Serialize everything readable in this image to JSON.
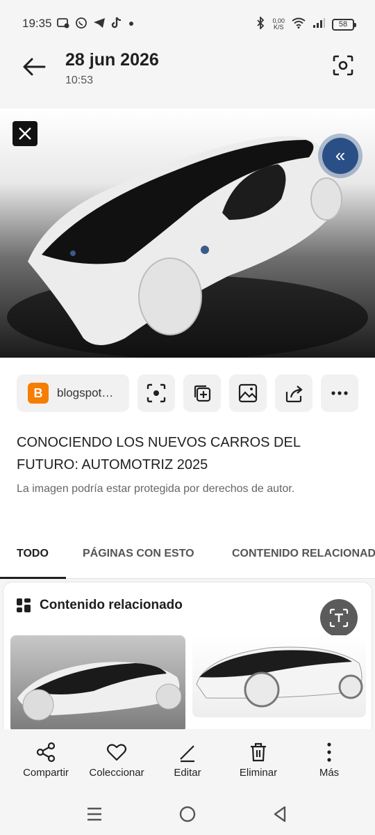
{
  "status_bar": {
    "time": "19:35",
    "net_speed_value": "0,00",
    "net_speed_unit": "K/S",
    "battery": "58",
    "icons": [
      "notification-icon",
      "whatsapp-icon",
      "telegram-icon",
      "tiktok-icon",
      "dot-icon",
      "bluetooth-icon",
      "wifi-icon",
      "signal-icon"
    ]
  },
  "header": {
    "title": "28 jun 2026",
    "subtitle": "10:53"
  },
  "source_chip": {
    "label": "blogspot…",
    "icon": "blogger-logo"
  },
  "action_icons": [
    "lens-search-icon",
    "add-collection-icon",
    "image-icon",
    "share-icon",
    "more-icon"
  ],
  "result": {
    "title": "CONOCIENDO LOS NUEVOS CARROS DEL FUTURO: AUTOMOTRIZ 2025",
    "copyright": "La imagen podría estar protegida por derechos de autor."
  },
  "tabs": [
    {
      "label": "TODO"
    },
    {
      "label": "PÁGINAS CON ESTO"
    },
    {
      "label": "CONTENIDO RELACIONADO"
    }
  ],
  "related": {
    "title": "Contenido relacionado"
  },
  "bottom_bar": [
    {
      "label": "Compartir",
      "icon": "share-nodes-icon"
    },
    {
      "label": "Coleccionar",
      "icon": "heart-icon"
    },
    {
      "label": "Editar",
      "icon": "edit-icon"
    },
    {
      "label": "Eliminar",
      "icon": "trash-icon"
    },
    {
      "label": "Más",
      "icon": "more-vertical-icon"
    }
  ],
  "colors": {
    "accent_blue": "#2a4f87",
    "blogger_orange": "#f57d00"
  }
}
